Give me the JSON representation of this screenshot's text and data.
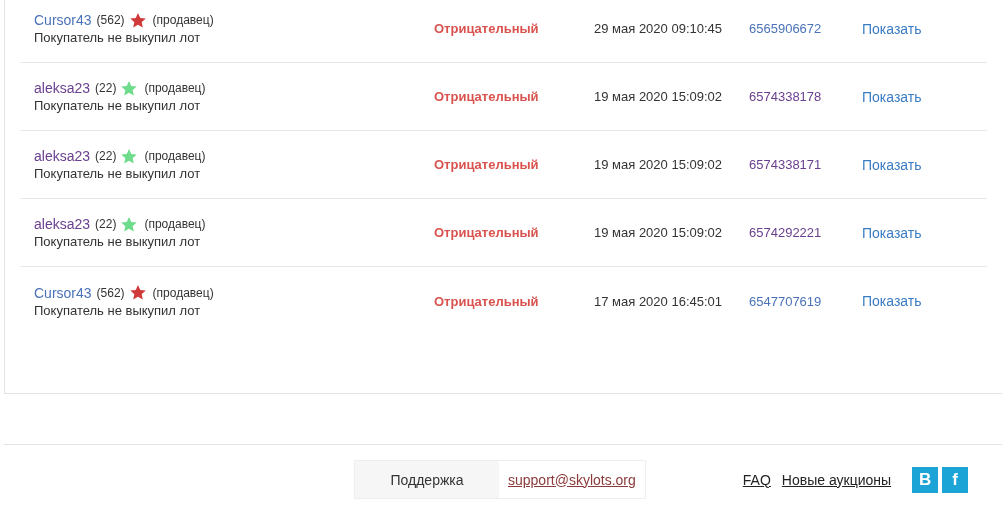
{
  "reviews": [
    {
      "user": "Cursor43",
      "user_visited": false,
      "count": "(562)",
      "color": "#d03a3a",
      "role": "(продавец)",
      "comment": "Покупатель не выкупил лот",
      "status": "Отрицательный",
      "date": "29 мая 2020 09:10:45",
      "lot": "6565906672",
      "lot_visited": false,
      "action": "Показать"
    },
    {
      "user": "aleksa23",
      "user_visited": true,
      "count": "(22)",
      "color": "#6fdc8c",
      "role": "(продавец)",
      "comment": "Покупатель не выкупил лот",
      "status": "Отрицательный",
      "date": "19 мая 2020 15:09:02",
      "lot": "6574338178",
      "lot_visited": true,
      "action": "Показать"
    },
    {
      "user": "aleksa23",
      "user_visited": true,
      "count": "(22)",
      "color": "#6fdc8c",
      "role": "(продавец)",
      "comment": "Покупатель не выкупил лот",
      "status": "Отрицательный",
      "date": "19 мая 2020 15:09:02",
      "lot": "6574338171",
      "lot_visited": true,
      "action": "Показать"
    },
    {
      "user": "aleksa23",
      "user_visited": true,
      "count": "(22)",
      "color": "#6fdc8c",
      "role": "(продавец)",
      "comment": "Покупатель не выкупил лот",
      "status": "Отрицательный",
      "date": "19 мая 2020 15:09:02",
      "lot": "6574292221",
      "lot_visited": true,
      "action": "Показать"
    },
    {
      "user": "Cursor43",
      "user_visited": false,
      "count": "(562)",
      "color": "#d03a3a",
      "role": "(продавец)",
      "comment": "Покупатель не выкупил лот",
      "status": "Отрицательный",
      "date": "17 мая 2020 16:45:01",
      "lot": "6547707619",
      "lot_visited": false,
      "action": "Показать"
    }
  ],
  "footer": {
    "support_label": "Поддержка",
    "support_email": "support@skylots.org",
    "links": [
      "FAQ",
      "Новые аукционы"
    ],
    "social": [
      {
        "label": "В"
      },
      {
        "label": "f"
      }
    ]
  }
}
